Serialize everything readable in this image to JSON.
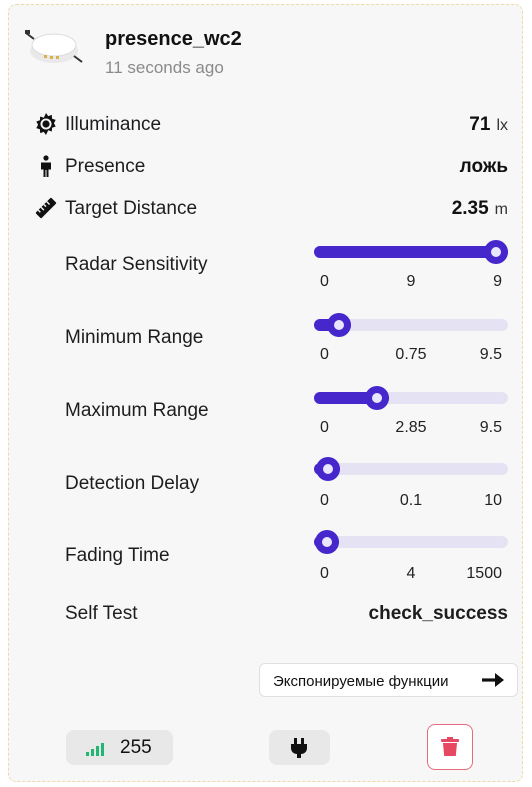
{
  "device": {
    "name": "presence_wc2",
    "last_seen": "11 seconds ago"
  },
  "readings": {
    "illuminance": {
      "label": "Illuminance",
      "value": "71",
      "unit": "lx",
      "icon": "sun-gear-icon"
    },
    "presence": {
      "label": "Presence",
      "value": "ложь",
      "icon": "person-icon"
    },
    "target_distance": {
      "label": "Target Distance",
      "value": "2.35",
      "unit": "m",
      "icon": "ruler-icon"
    }
  },
  "sliders": [
    {
      "label": "Radar Sensitivity",
      "min": "0",
      "value": "9",
      "max": "9",
      "fraction": 1.0
    },
    {
      "label": "Minimum Range",
      "min": "0",
      "value": "0.75",
      "max": "9.5",
      "fraction": 0.079
    },
    {
      "label": "Maximum Range",
      "min": "0",
      "value": "2.85",
      "max": "9.5",
      "fraction": 0.3
    },
    {
      "label": "Detection Delay",
      "min": "0",
      "value": "0.1",
      "max": "10",
      "fraction": 0.01
    },
    {
      "label": "Fading Time",
      "min": "0",
      "value": "4",
      "max": "1500",
      "fraction": 0.003
    }
  ],
  "self_test": {
    "label": "Self Test",
    "value": "check_success"
  },
  "exposes_button": {
    "label": "Экспонируемые функции",
    "icon": "arrow-right-icon"
  },
  "footer": {
    "lqi": "255",
    "lqi_icon": "signal-icon",
    "power_icon": "plug-icon",
    "delete_icon": "trash-icon"
  },
  "colors": {
    "accent": "#4527cc",
    "track": "#e5e3f3",
    "delete": "#e54860",
    "signal": "#22b573"
  }
}
